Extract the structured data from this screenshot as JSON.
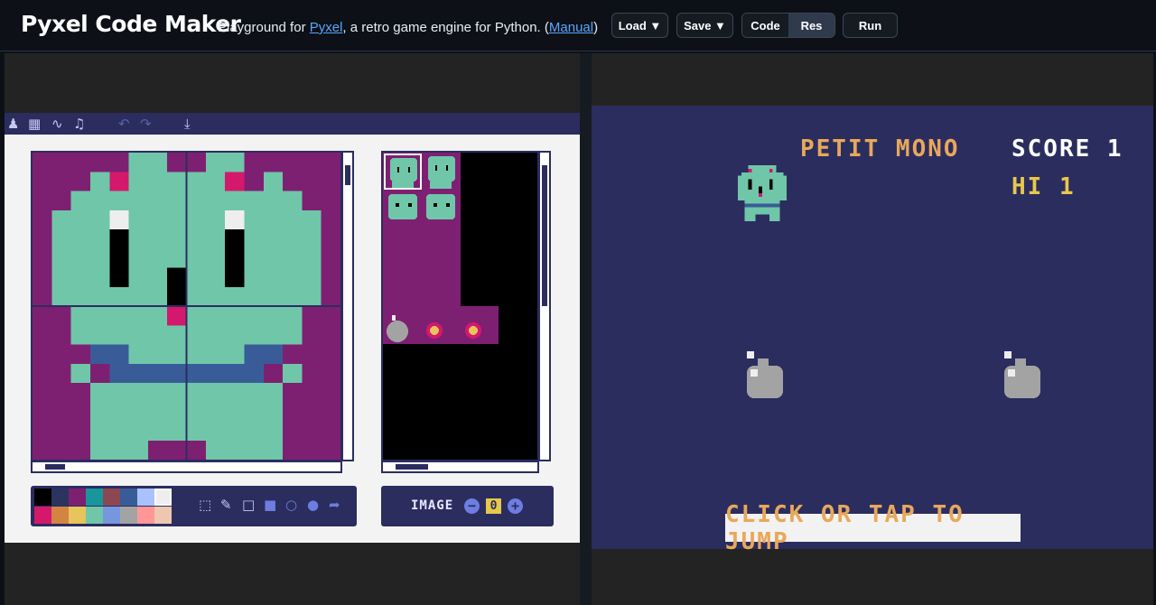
{
  "header": {
    "title": "Pyxel Code Maker",
    "tagline_prefix": "Playground for ",
    "tagline_link": "Pyxel",
    "tagline_middle": ", a retro game engine for Python. (",
    "tagline_manual": "Manual",
    "tagline_suffix": ")",
    "load_label": "Load ▼",
    "save_label": "Save ▼",
    "code_label": "Code",
    "res_label": "Res",
    "run_label": "Run"
  },
  "editor": {
    "image_label": "IMAGE",
    "image_number": "0",
    "minus": "−",
    "plus": "+",
    "palette": [
      "#000000",
      "#2b335f",
      "#7e2072",
      "#19959c",
      "#8b4852",
      "#395c98",
      "#a9c1ff",
      "#eeeeee",
      "#d4186c",
      "#d38441",
      "#e9c35b",
      "#70c6a9",
      "#7696de",
      "#a3a3a3",
      "#ff9798",
      "#edc7b0"
    ]
  },
  "game": {
    "title": "PETIT MONO",
    "score": "SCORE 1",
    "hi": "HI 1",
    "prompt": "CLICK OR TAP TO JUMP"
  }
}
